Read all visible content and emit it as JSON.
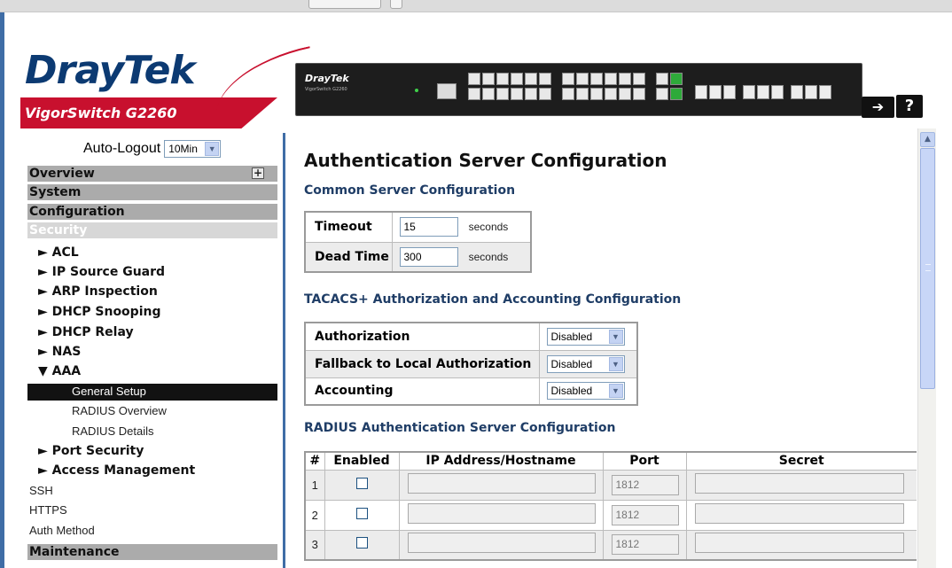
{
  "header": {
    "brand_dray": "Dray",
    "brand_tek": "Tek",
    "model": "VigorSwitch G2260",
    "device_brand": "DrayTek",
    "device_model": "VigorSwitch G2260",
    "logout_glyph": "➔",
    "help_glyph": "?"
  },
  "sidebar": {
    "autologout_label": "Auto-Logout",
    "autologout_value": "10Min",
    "sections": {
      "overview": "Overview",
      "system": "System",
      "configuration": "Configuration",
      "security": "Security",
      "maintenance": "Maintenance"
    },
    "security_items": [
      "► ACL",
      "► IP Source Guard",
      "► ARP Inspection",
      "► DHCP Snooping",
      "► DHCP Relay",
      "► NAS",
      "▼ AAA",
      "► Port Security",
      "► Access Management"
    ],
    "aaa_items": [
      "General Setup",
      "RADIUS Overview",
      "RADIUS Details"
    ],
    "plain_items": [
      "SSH",
      "HTTPS",
      "Auth Method"
    ]
  },
  "content": {
    "page_title": "Authentication Server Configuration",
    "common": {
      "title": "Common Server Configuration",
      "timeout_label": "Timeout",
      "timeout_value": "15",
      "deadtime_label": "Dead Time",
      "deadtime_value": "300",
      "unit": "seconds"
    },
    "tacacs": {
      "title": "TACACS+ Authorization and Accounting Configuration",
      "rows": [
        {
          "label": "Authorization",
          "value": "Disabled"
        },
        {
          "label": "Fallback to Local Authorization",
          "value": "Disabled"
        },
        {
          "label": "Accounting",
          "value": "Disabled"
        }
      ]
    },
    "radius": {
      "title": "RADIUS Authentication Server Configuration",
      "headers": [
        "#",
        "Enabled",
        "IP Address/Hostname",
        "Port",
        "Secret"
      ],
      "rows": [
        {
          "num": "1",
          "port": "1812"
        },
        {
          "num": "2",
          "port": "1812"
        },
        {
          "num": "3",
          "port": "1812"
        }
      ]
    }
  },
  "colors": {
    "brand_navy": "#0c3a72",
    "brand_red": "#c8102e",
    "accent_blue": "#3f6da6",
    "section_heading": "#1f3d66"
  }
}
